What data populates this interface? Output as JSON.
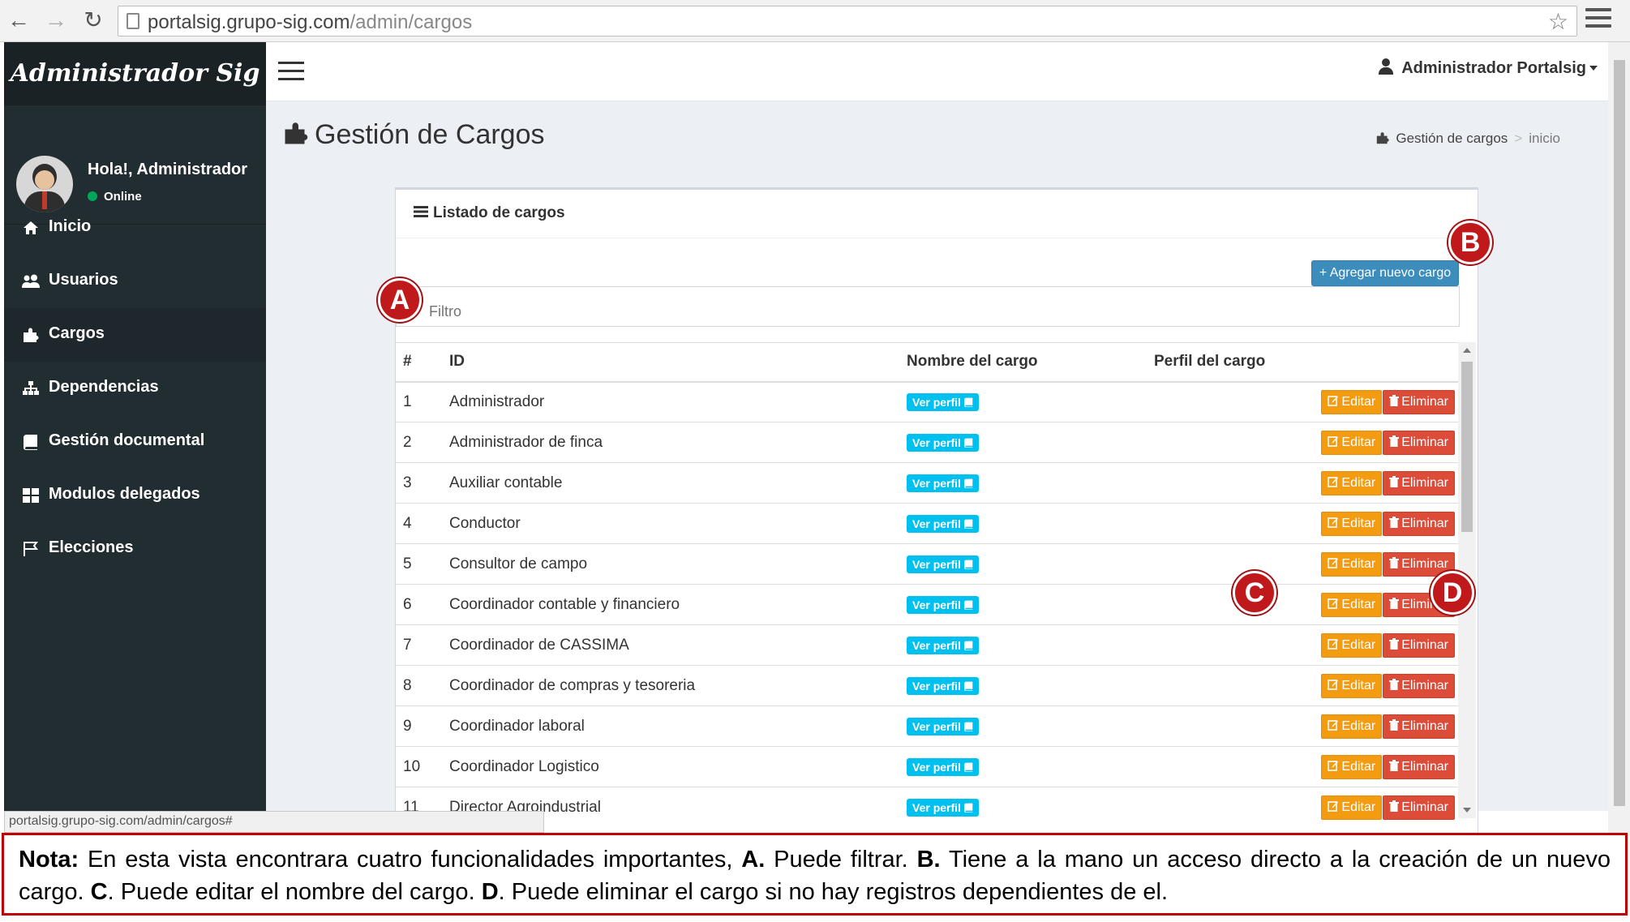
{
  "browser": {
    "url_host": "portalsig.grupo-sig.com",
    "url_path": "/admin/cargos",
    "status_url": "portalsig.grupo-sig.com/admin/cargos#"
  },
  "sidebar": {
    "brand": "Administrador Sig",
    "greeting": "Hola!, Administrador",
    "status": "Online",
    "items": [
      {
        "label": "Inicio",
        "icon": "home-icon"
      },
      {
        "label": "Usuarios",
        "icon": "users-icon"
      },
      {
        "label": "Cargos",
        "icon": "puzzle-icon"
      },
      {
        "label": "Dependencias",
        "icon": "sitemap-icon"
      },
      {
        "label": "Gestión documental",
        "icon": "book-icon"
      },
      {
        "label": "Modulos delegados",
        "icon": "grid-icon"
      },
      {
        "label": "Elecciones",
        "icon": "flag-icon"
      }
    ],
    "active": "Cargos"
  },
  "header": {
    "account": "Administrador Portalsig"
  },
  "page": {
    "title": "Gestión de Cargos",
    "breadcrumb": [
      "Gestión de cargos",
      "inicio"
    ]
  },
  "box": {
    "title": "Listado de cargos",
    "add_label": "+ Agregar nuevo cargo",
    "filter_placeholder": "Filtro"
  },
  "table": {
    "columns": [
      "#",
      "ID",
      "Nombre del cargo",
      "Perfil del cargo"
    ],
    "profile_label": "Ver perfil",
    "edit_label": "Editar",
    "delete_label": "Eliminar",
    "rows": [
      {
        "num": "1",
        "id": "Administrador"
      },
      {
        "num": "2",
        "id": "Administrador de finca"
      },
      {
        "num": "3",
        "id": "Auxiliar contable"
      },
      {
        "num": "4",
        "id": "Conductor"
      },
      {
        "num": "5",
        "id": "Consultor de campo"
      },
      {
        "num": "6",
        "id": "Coordinador contable y financiero"
      },
      {
        "num": "7",
        "id": "Coordinador de CASSIMA"
      },
      {
        "num": "8",
        "id": "Coordinador de compras y tesoreria"
      },
      {
        "num": "9",
        "id": "Coordinador laboral"
      },
      {
        "num": "10",
        "id": "Coordinador Logistico"
      },
      {
        "num": "11",
        "id": "Director Agroindustrial"
      }
    ]
  },
  "markers": {
    "a": "A",
    "b": "B",
    "c": "C",
    "d": "D"
  },
  "note": {
    "lead": "Nota:",
    "t1": " En esta vista encontrara cuatro funcionalidades importantes, ",
    "a": "A.",
    "t2": " Puede filtrar. ",
    "b": "B.",
    "t3": " Tiene a la mano un acceso directo a la creación de un nuevo cargo. ",
    "c": "C",
    "t4": ". Puede editar el nombre del cargo. ",
    "d": "D",
    "t5": ". Puede eliminar el cargo si no hay registros dependientes de el."
  },
  "colors": {
    "sidebar_bg": "#222d32",
    "primary": "#3c8dbc",
    "info": "#00c0ef",
    "warning": "#f39c12",
    "danger": "#dd4b39",
    "marker": "#c0191b"
  }
}
